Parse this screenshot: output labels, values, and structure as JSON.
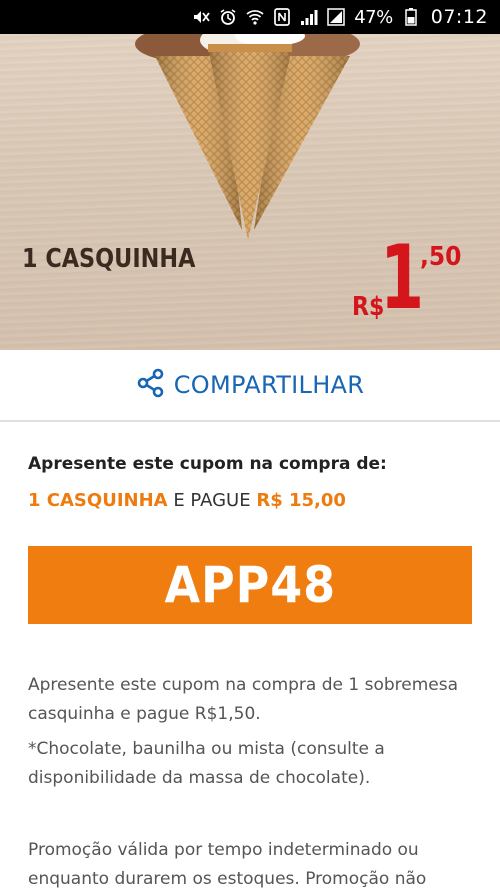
{
  "status_bar": {
    "battery": "47%",
    "time": "07:12",
    "icons": [
      "mute-icon",
      "alarm-icon",
      "wifi-icon",
      "nfc-icon",
      "signal-icon",
      "signal-r-icon",
      "battery-icon"
    ]
  },
  "hero": {
    "product": "1 CASQUINHA",
    "price": {
      "currency": "R$",
      "integer": "1",
      "decimals": ",50"
    }
  },
  "share": {
    "label": "COMPARTILHAR",
    "icon": "share-icon"
  },
  "instruction": "Apresente este cupom na compra de:",
  "offer": {
    "item": "1 CASQUINHA",
    "connector": "E PAGUE",
    "price": "R$ 15,00"
  },
  "coupon_code": "APP48",
  "description": [
    "Apresente este cupom na compra de 1 sobremesa casquinha e pague R$1,50.",
    "*Chocolate, baunilha ou mista (consulte a disponibilidade da massa de chocolate).",
    "Promoção válida por tempo indeterminado ou enquanto durarem os estoques. Promoção não"
  ],
  "colors": {
    "accent": "#ef7d10",
    "link": "#1866b4",
    "price": "#d4151b"
  }
}
